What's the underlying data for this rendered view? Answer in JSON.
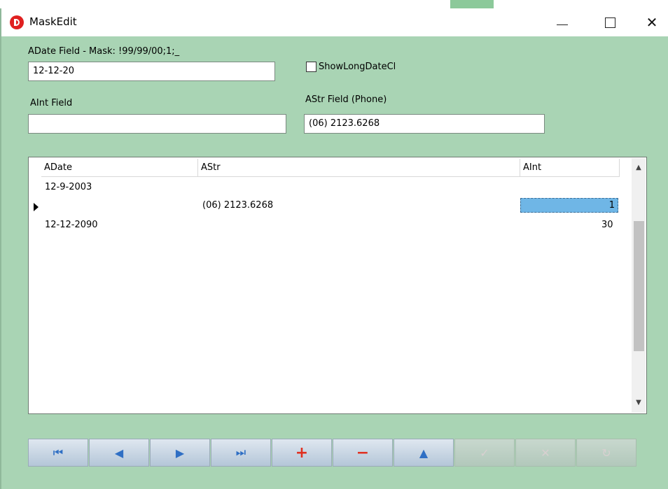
{
  "window": {
    "title": "MaskEdit",
    "buttons": {
      "minimize": "—",
      "maximize": "",
      "close": "✕"
    }
  },
  "form": {
    "adate_label": "ADate Field - Mask: !99/99/00;1;_",
    "adate_value": "12-12-20",
    "checkbox_label": "ShowLongDateCl",
    "checkbox_checked": false,
    "aint_label": "AInt Field",
    "aint_value": "",
    "astr_label": "AStr Field (Phone)",
    "astr_value": "(06) 2123.6268"
  },
  "grid": {
    "columns": [
      "ADate",
      "AStr",
      "AInt"
    ],
    "rows": [
      {
        "adate": "12-9-2003",
        "astr": "",
        "aint": ""
      },
      {
        "adate": "",
        "astr": "(06) 2123.6268",
        "aint": "1"
      },
      {
        "adate": "12-12-2090",
        "astr": "",
        "aint": "30"
      }
    ],
    "scroll_up": "▲",
    "scroll_down": "▼"
  },
  "navigator": {
    "buttons": [
      {
        "name": "first-record",
        "icon": "first-icon",
        "glyph": "⏮",
        "enabled": true
      },
      {
        "name": "prior-record",
        "icon": "prior-icon",
        "glyph": "◀",
        "enabled": true
      },
      {
        "name": "next-record",
        "icon": "next-icon",
        "glyph": "▶",
        "enabled": true
      },
      {
        "name": "last-record",
        "icon": "last-icon",
        "glyph": "⏭",
        "enabled": true
      },
      {
        "name": "insert-record",
        "icon": "plus-icon",
        "glyph": "+",
        "enabled": true
      },
      {
        "name": "delete-record",
        "icon": "minus-icon",
        "glyph": "−",
        "enabled": true
      },
      {
        "name": "edit-record",
        "icon": "up-triangle-icon",
        "glyph": "▲",
        "enabled": true
      },
      {
        "name": "post-record",
        "icon": "check-icon",
        "glyph": "✓",
        "enabled": false
      },
      {
        "name": "cancel-record",
        "icon": "x-icon",
        "glyph": "✕",
        "enabled": false
      },
      {
        "name": "refresh-record",
        "icon": "refresh-icon",
        "glyph": "↻",
        "enabled": false
      }
    ]
  }
}
